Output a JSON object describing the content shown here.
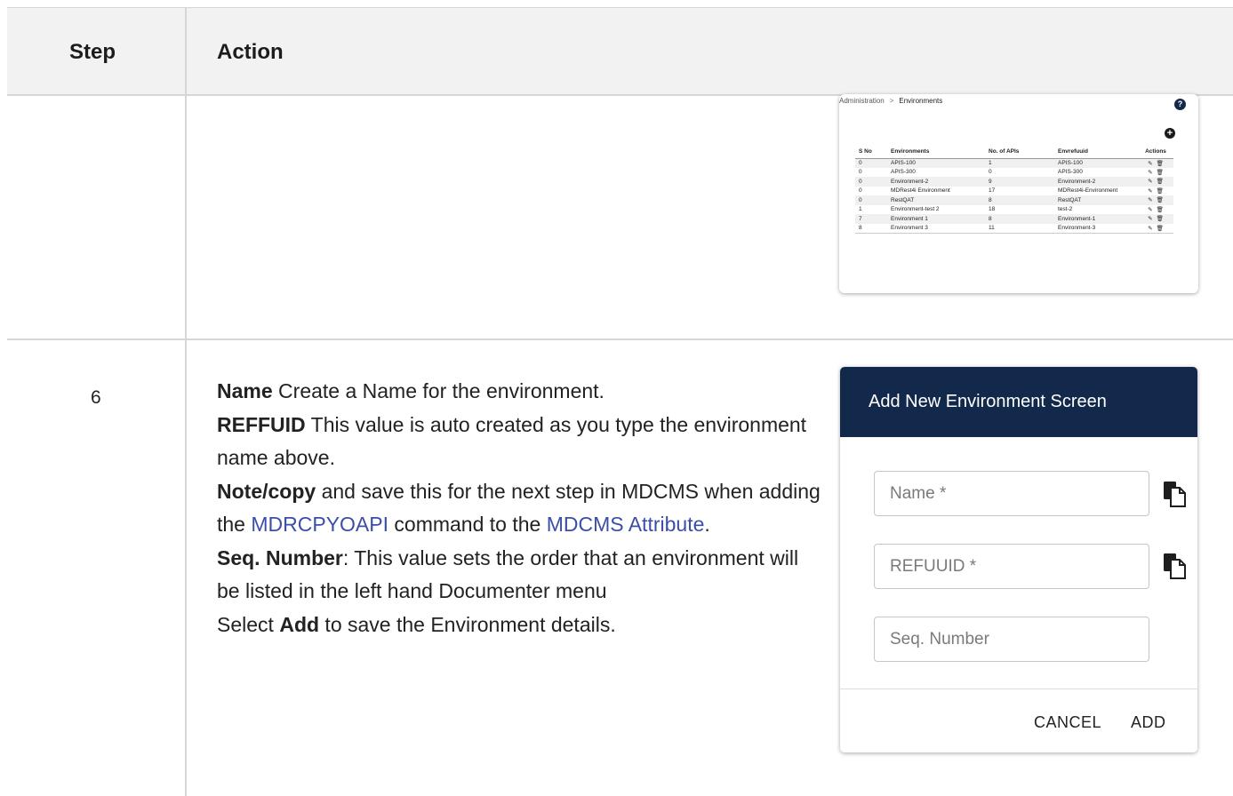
{
  "table_header": {
    "step": "Step",
    "action": "Action"
  },
  "environments_screen": {
    "breadcrumb": {
      "parent": "Administration",
      "separator": ">",
      "current": "Environments"
    },
    "help_icon": "question-circle-icon",
    "add_icon": "plus-circle-icon",
    "columns": [
      "S No",
      "Environments",
      "No. of APIs",
      "Envrefuuid",
      "Actions"
    ],
    "rows": [
      [
        "0",
        "APIS-100",
        "1",
        "APIS-100"
      ],
      [
        "0",
        "APIS-300",
        "0",
        "APIS-300"
      ],
      [
        "0",
        "Environment-2",
        "9",
        "Environment-2"
      ],
      [
        "0",
        "MDRest4i Environment",
        "17",
        "MDRest4i-Environment"
      ],
      [
        "0",
        "RestQAT",
        "8",
        "RestQAT"
      ],
      [
        "1",
        "Environment-test 2",
        "18",
        "test-2"
      ],
      [
        "7",
        "Environment 1",
        "8",
        "Environment-1"
      ],
      [
        "8",
        "Environment 3",
        "11",
        "Environment-3"
      ]
    ],
    "row_action_icons": [
      "edit-icon",
      "trash-icon"
    ]
  },
  "step6": {
    "number": "6",
    "name_label": "Name",
    "name_text": " Create a Name for the environment.",
    "reffuid_label": "REFFUID",
    "reffuid_text": " This value is auto created as you type the environment name above.",
    "note_label": "Note/copy",
    "note_text_1": " and save this for the next step in MDCMS when adding the ",
    "note_link_1": "MDRCPYOAPI",
    "note_text_2": " command to the ",
    "note_link_2": "MDCMS Attribute",
    "note_text_3": ".",
    "seq_label": "Seq. Number",
    "seq_text": ": This value sets the order that an environment will be listed in the left hand Documenter menu",
    "select_text_1": "Select ",
    "select_label": "Add",
    "select_text_2": " to save the Environment details."
  },
  "dialog": {
    "title": "Add New Environment Screen",
    "name_placeholder": "Name *",
    "refuuid_placeholder": "REFUUID *",
    "seq_placeholder": "Seq. Number",
    "copy_icon": "copy-clipboard-icon",
    "cancel_label": "CANCEL",
    "add_label": "ADD",
    "header_color": "#13294b"
  }
}
